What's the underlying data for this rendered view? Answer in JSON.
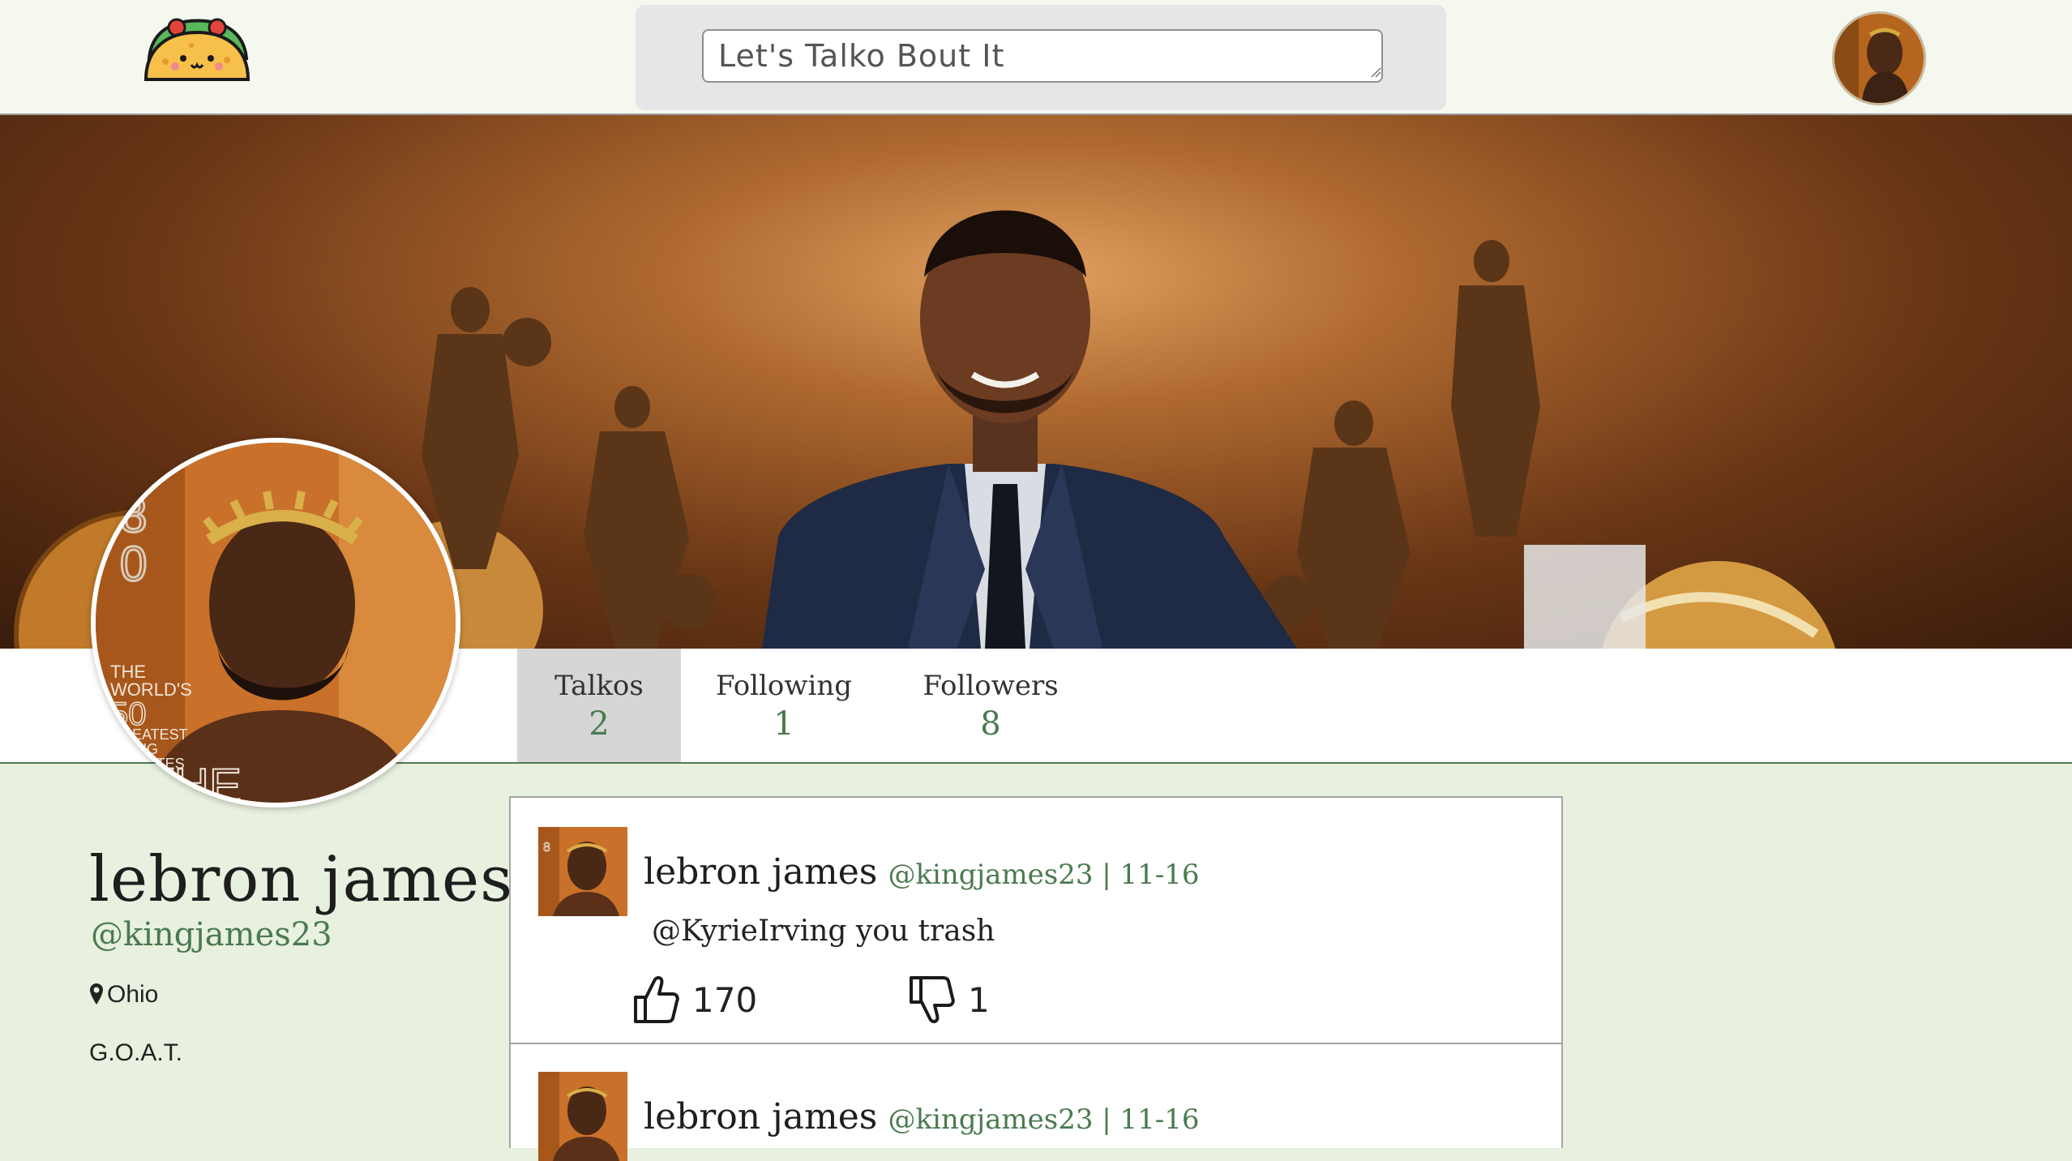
{
  "nav": {
    "logo_icon": "taco-logo-icon",
    "search_placeholder": "Let's Talko Bout It",
    "avatar_icon": "user-avatar-icon"
  },
  "profile": {
    "name": "lebron james",
    "handle": "@kingjames23",
    "location": "Ohio",
    "bio": "G.O.A.T."
  },
  "tabs": [
    {
      "label": "Talkos",
      "count": "2",
      "active": true
    },
    {
      "label": "Following",
      "count": "1",
      "active": false
    },
    {
      "label": "Followers",
      "count": "8",
      "active": false
    }
  ],
  "posts": [
    {
      "author": "lebron james",
      "meta": "@kingjames23 | 11-16",
      "body": "@KyrieIrving you trash",
      "likes": "170",
      "dislikes": "1"
    },
    {
      "author": "lebron james",
      "meta": "@kingjames23 | 11-16"
    }
  ],
  "colors": {
    "accent_green": "#4a7a4f",
    "page_background": "#e8f0e0",
    "active_tab": "#d6d6d6"
  }
}
